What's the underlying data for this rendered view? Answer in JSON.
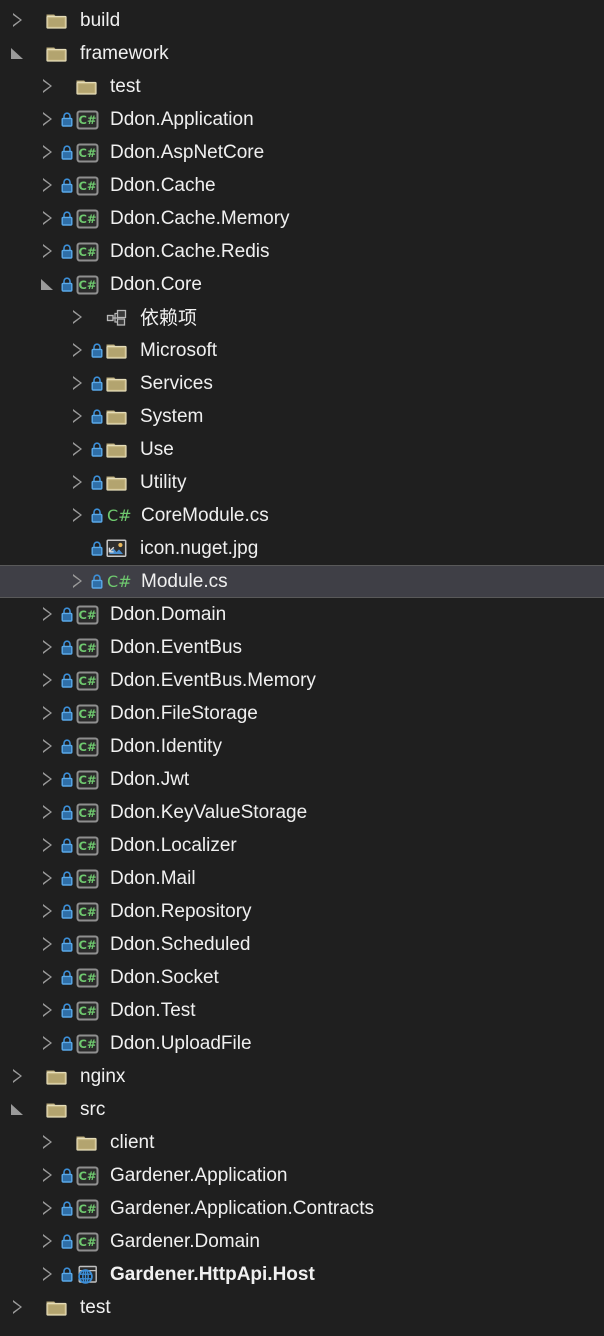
{
  "theme": {
    "background": "#1f1f1f",
    "selected_background": "#3f3f46",
    "selected_border": "#595959",
    "text_color": "#f0f0f0",
    "arrow_color": "#9a9a9a",
    "folder_color": "#c5b47f",
    "csharp_green": "#6fc96f",
    "lock_blue": "#3c8fd8",
    "web_blue": "#3c8fd8"
  },
  "panel": {
    "name": "solution-explorer-tree"
  },
  "tree": [
    {
      "label": "build",
      "depth": 0,
      "state": "collapsed",
      "lock": false,
      "icon": "folder-icon",
      "selected": false,
      "bold": false
    },
    {
      "label": "framework",
      "depth": 0,
      "state": "expanded",
      "lock": false,
      "icon": "folder-icon",
      "selected": false,
      "bold": false
    },
    {
      "label": "test",
      "depth": 1,
      "state": "collapsed",
      "lock": false,
      "icon": "folder-icon",
      "selected": false,
      "bold": false
    },
    {
      "label": "Ddon.Application",
      "depth": 1,
      "state": "collapsed",
      "lock": true,
      "icon": "csharp-project-icon",
      "selected": false,
      "bold": false
    },
    {
      "label": "Ddon.AspNetCore",
      "depth": 1,
      "state": "collapsed",
      "lock": true,
      "icon": "csharp-project-icon",
      "selected": false,
      "bold": false
    },
    {
      "label": "Ddon.Cache",
      "depth": 1,
      "state": "collapsed",
      "lock": true,
      "icon": "csharp-project-icon",
      "selected": false,
      "bold": false
    },
    {
      "label": "Ddon.Cache.Memory",
      "depth": 1,
      "state": "collapsed",
      "lock": true,
      "icon": "csharp-project-icon",
      "selected": false,
      "bold": false
    },
    {
      "label": "Ddon.Cache.Redis",
      "depth": 1,
      "state": "collapsed",
      "lock": true,
      "icon": "csharp-project-icon",
      "selected": false,
      "bold": false
    },
    {
      "label": "Ddon.Core",
      "depth": 1,
      "state": "expanded",
      "lock": true,
      "icon": "csharp-project-icon",
      "selected": false,
      "bold": false
    },
    {
      "label": "依赖项",
      "depth": 2,
      "state": "collapsed",
      "lock": false,
      "icon": "dependencies-icon",
      "selected": false,
      "bold": false,
      "cjk": true
    },
    {
      "label": "Microsoft",
      "depth": 2,
      "state": "collapsed",
      "lock": true,
      "icon": "folder-icon",
      "selected": false,
      "bold": false
    },
    {
      "label": "Services",
      "depth": 2,
      "state": "collapsed",
      "lock": true,
      "icon": "folder-icon",
      "selected": false,
      "bold": false
    },
    {
      "label": "System",
      "depth": 2,
      "state": "collapsed",
      "lock": true,
      "icon": "folder-icon",
      "selected": false,
      "bold": false
    },
    {
      "label": "Use",
      "depth": 2,
      "state": "collapsed",
      "lock": true,
      "icon": "folder-icon",
      "selected": false,
      "bold": false
    },
    {
      "label": "Utility",
      "depth": 2,
      "state": "collapsed",
      "lock": true,
      "icon": "folder-icon",
      "selected": false,
      "bold": false
    },
    {
      "label": "CoreModule.cs",
      "depth": 2,
      "state": "collapsed",
      "lock": true,
      "icon": "csharp-file-icon",
      "selected": false,
      "bold": false
    },
    {
      "label": "icon.nuget.jpg",
      "depth": 2,
      "state": "none",
      "lock": true,
      "icon": "image-file-icon",
      "selected": false,
      "bold": false
    },
    {
      "label": "Module.cs",
      "depth": 2,
      "state": "collapsed",
      "lock": true,
      "icon": "csharp-file-icon",
      "selected": true,
      "bold": false
    },
    {
      "label": "Ddon.Domain",
      "depth": 1,
      "state": "collapsed",
      "lock": true,
      "icon": "csharp-project-icon",
      "selected": false,
      "bold": false
    },
    {
      "label": "Ddon.EventBus",
      "depth": 1,
      "state": "collapsed",
      "lock": true,
      "icon": "csharp-project-icon",
      "selected": false,
      "bold": false
    },
    {
      "label": "Ddon.EventBus.Memory",
      "depth": 1,
      "state": "collapsed",
      "lock": true,
      "icon": "csharp-project-icon",
      "selected": false,
      "bold": false
    },
    {
      "label": "Ddon.FileStorage",
      "depth": 1,
      "state": "collapsed",
      "lock": true,
      "icon": "csharp-project-icon",
      "selected": false,
      "bold": false
    },
    {
      "label": "Ddon.Identity",
      "depth": 1,
      "state": "collapsed",
      "lock": true,
      "icon": "csharp-project-icon",
      "selected": false,
      "bold": false
    },
    {
      "label": "Ddon.Jwt",
      "depth": 1,
      "state": "collapsed",
      "lock": true,
      "icon": "csharp-project-icon",
      "selected": false,
      "bold": false
    },
    {
      "label": "Ddon.KeyValueStorage",
      "depth": 1,
      "state": "collapsed",
      "lock": true,
      "icon": "csharp-project-icon",
      "selected": false,
      "bold": false
    },
    {
      "label": "Ddon.Localizer",
      "depth": 1,
      "state": "collapsed",
      "lock": true,
      "icon": "csharp-project-icon",
      "selected": false,
      "bold": false
    },
    {
      "label": "Ddon.Mail",
      "depth": 1,
      "state": "collapsed",
      "lock": true,
      "icon": "csharp-project-icon",
      "selected": false,
      "bold": false
    },
    {
      "label": "Ddon.Repository",
      "depth": 1,
      "state": "collapsed",
      "lock": true,
      "icon": "csharp-project-icon",
      "selected": false,
      "bold": false
    },
    {
      "label": "Ddon.Scheduled",
      "depth": 1,
      "state": "collapsed",
      "lock": true,
      "icon": "csharp-project-icon",
      "selected": false,
      "bold": false
    },
    {
      "label": "Ddon.Socket",
      "depth": 1,
      "state": "collapsed",
      "lock": true,
      "icon": "csharp-project-icon",
      "selected": false,
      "bold": false
    },
    {
      "label": "Ddon.Test",
      "depth": 1,
      "state": "collapsed",
      "lock": true,
      "icon": "csharp-project-icon",
      "selected": false,
      "bold": false
    },
    {
      "label": "Ddon.UploadFile",
      "depth": 1,
      "state": "collapsed",
      "lock": true,
      "icon": "csharp-project-icon",
      "selected": false,
      "bold": false
    },
    {
      "label": "nginx",
      "depth": 0,
      "state": "collapsed",
      "lock": false,
      "icon": "folder-icon",
      "selected": false,
      "bold": false
    },
    {
      "label": "src",
      "depth": 0,
      "state": "expanded",
      "lock": false,
      "icon": "folder-icon",
      "selected": false,
      "bold": false
    },
    {
      "label": "client",
      "depth": 1,
      "state": "collapsed",
      "lock": false,
      "icon": "folder-icon",
      "selected": false,
      "bold": false
    },
    {
      "label": "Gardener.Application",
      "depth": 1,
      "state": "collapsed",
      "lock": true,
      "icon": "csharp-project-icon",
      "selected": false,
      "bold": false
    },
    {
      "label": "Gardener.Application.Contracts",
      "depth": 1,
      "state": "collapsed",
      "lock": true,
      "icon": "csharp-project-icon",
      "selected": false,
      "bold": false
    },
    {
      "label": "Gardener.Domain",
      "depth": 1,
      "state": "collapsed",
      "lock": true,
      "icon": "csharp-project-icon",
      "selected": false,
      "bold": false
    },
    {
      "label": "Gardener.HttpApi.Host",
      "depth": 1,
      "state": "collapsed",
      "lock": true,
      "icon": "web-project-icon",
      "selected": false,
      "bold": true
    },
    {
      "label": "test",
      "depth": 0,
      "state": "collapsed",
      "lock": false,
      "icon": "folder-icon",
      "selected": false,
      "bold": false
    }
  ]
}
